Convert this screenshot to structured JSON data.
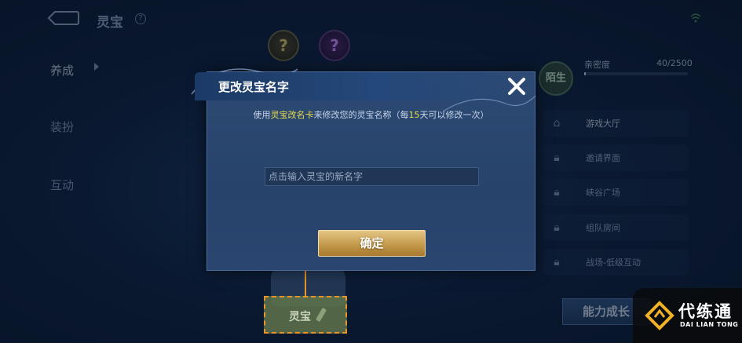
{
  "header": {
    "title": "灵宝",
    "help": "?"
  },
  "left_menu": [
    {
      "label": "养成"
    },
    {
      "label": "装扮"
    },
    {
      "label": "互动"
    }
  ],
  "badges": [
    {
      "icon": "question-badge-gold",
      "glyph": "?"
    },
    {
      "icon": "question-badge-purple",
      "glyph": "?"
    }
  ],
  "right_panel": {
    "relation": "陌生",
    "intimacy_label": "亲密度",
    "intimacy_value": "40/2500",
    "intimacy_fraction": 0.016,
    "items": [
      {
        "icon": "home-icon",
        "label": "游戏大厅"
      },
      {
        "icon": "lock-icon",
        "label": "邀请界面"
      },
      {
        "icon": "lock-icon",
        "label": "峡谷广场"
      },
      {
        "icon": "lock-icon",
        "label": "组队房间"
      },
      {
        "icon": "lock-icon",
        "label": "战场-低级互动"
      }
    ],
    "ability_button": "能力成长"
  },
  "dialog": {
    "title": "更改灵宝名字",
    "desc_prefix": "使用",
    "desc_card": "灵宝改名卡",
    "desc_mid": "来修改您的灵宝名称（每",
    "desc_days": "15",
    "desc_suffix": "天可以修改一次）",
    "input_placeholder": "点击输入灵宝的新名字",
    "confirm_label": "确定"
  },
  "bottom_tab": {
    "label": "灵宝"
  },
  "watermark": {
    "cn": "代练通",
    "en": "DAI LIAN TONG"
  },
  "colors": {
    "highlight_yellow": "#e9de4a",
    "guide_orange": "#e8962a",
    "confirm_gold": "#c49a4c"
  }
}
